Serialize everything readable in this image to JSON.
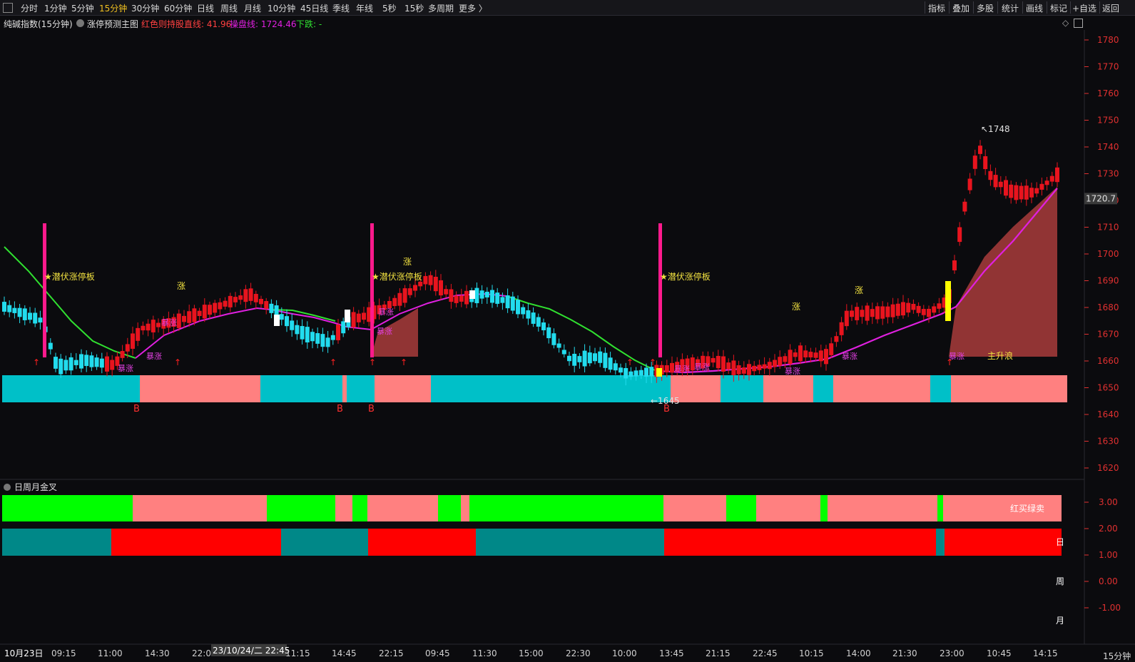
{
  "toolbar": {
    "periods": [
      "分时",
      "1分钟",
      "5分钟",
      "15分钟",
      "30分钟",
      "60分钟",
      "日线",
      "周线",
      "月线",
      "10分钟",
      "45日线",
      "季线",
      "年线",
      "5秒",
      "15秒",
      "多周期",
      "更多 〉"
    ],
    "active_period": "15分钟",
    "right_buttons": [
      "指标",
      "叠加",
      "多股",
      "统计",
      "画线",
      "标记",
      "+自选",
      "返回"
    ]
  },
  "info": {
    "symbol": "纯碱指数(15分钟)",
    "indicator": "涨停预测主图",
    "red_line": "红色则持股直线: 41.96",
    "operate_line": "操盘线: 1724.46",
    "down_label": "下跌: -"
  },
  "price_axis": {
    "ticks": [
      "1780",
      "1770",
      "1760",
      "1750",
      "1740",
      "1730",
      "1720",
      "1710",
      "1700",
      "1690",
      "1680",
      "1670",
      "1660",
      "1650",
      "1640",
      "1630",
      "1620"
    ],
    "current_price": "1720.7"
  },
  "annotations": {
    "high_label": "1748",
    "low_label": "1645",
    "star_signal": "★潜伏涨停板",
    "rise": "涨",
    "buy": "B",
    "main_wave": "主升浪",
    "surge": "暴涨"
  },
  "sub_panel": {
    "title": "日周月金叉",
    "legend": "红买绿卖",
    "ticks": [
      "3.00",
      "2.00",
      "1.00",
      "0.00",
      "-1.00"
    ],
    "labels": [
      "日",
      "周",
      "月"
    ]
  },
  "time_axis": {
    "labels": [
      "10月23日",
      "09:15",
      "11:00",
      "14:30",
      "22:00",
      "11:15",
      "14:45",
      "22:15",
      "09:45",
      "11:30",
      "15:00",
      "22:30",
      "10:00",
      "13:45",
      "21:15",
      "22:45",
      "10:15",
      "14:00",
      "21:30",
      "23:00",
      "10:45",
      "14:15"
    ],
    "cursor_time": "23/10/24/二 22:45",
    "period": "15分钟"
  },
  "colors": {
    "up": "#e8141e",
    "down": "#22dcee",
    "bull_band": "#ff8080",
    "bear_band": "#00c0c8",
    "ma_green": "#30e030",
    "ma_magenta": "#e020e0",
    "pink_bar": "#ff1a8c"
  }
}
